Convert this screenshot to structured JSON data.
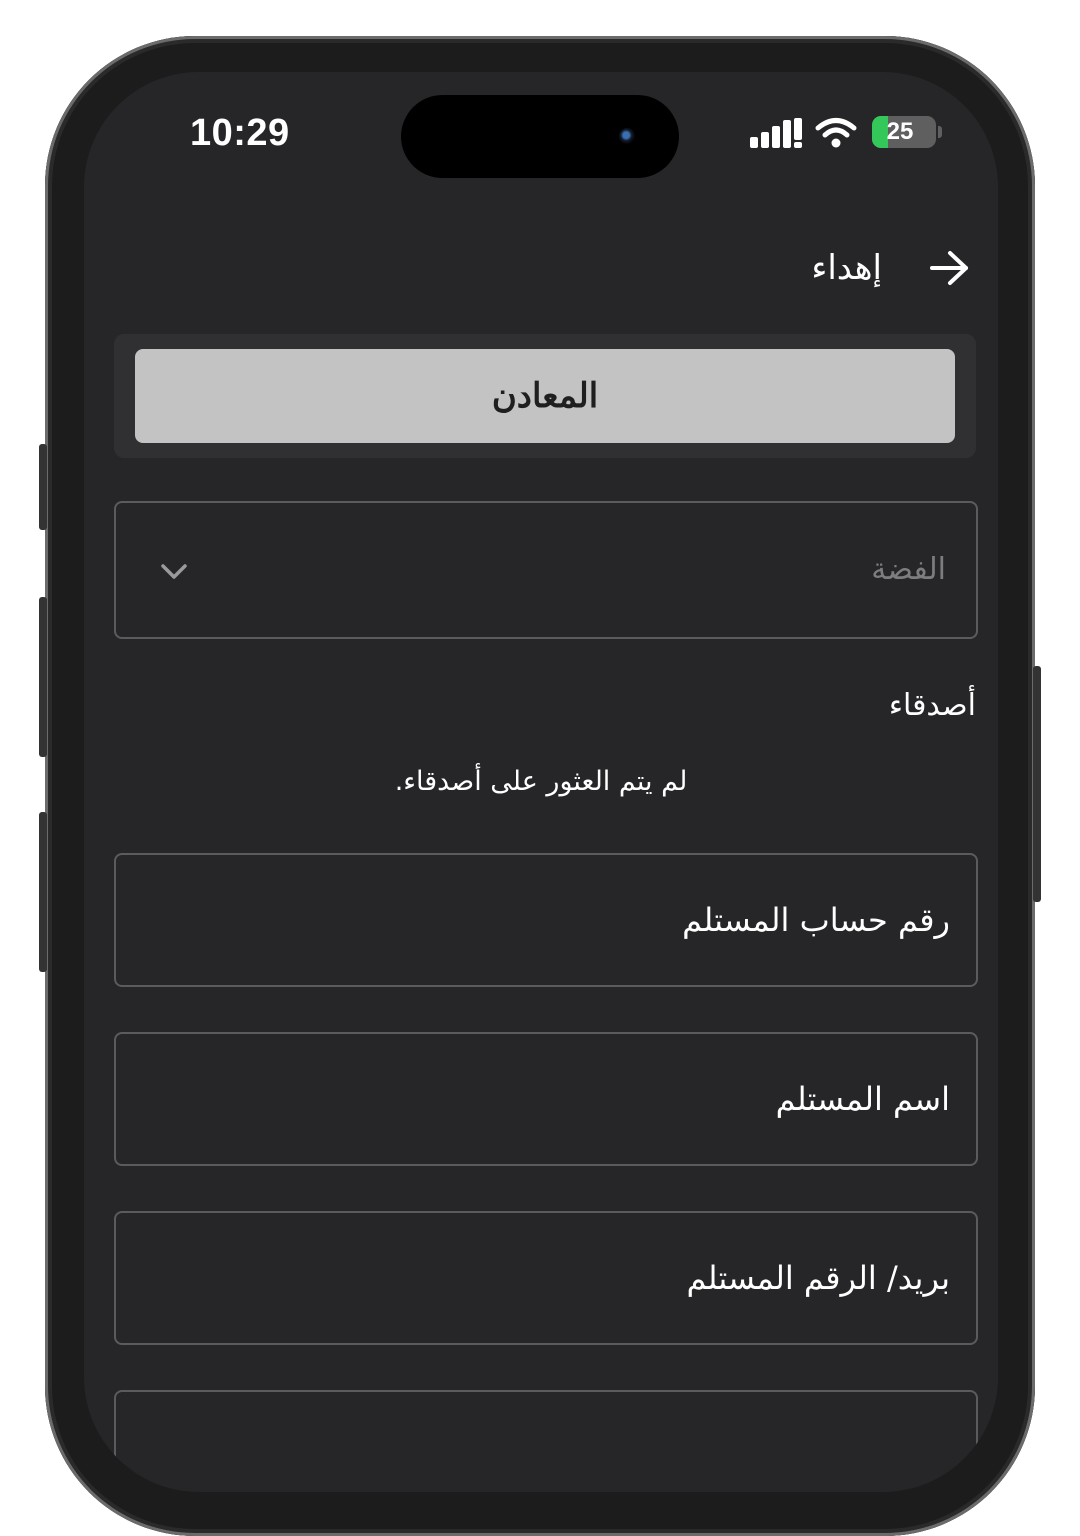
{
  "status_bar": {
    "time": "10:29",
    "battery_level": "25",
    "battery_fraction": 0.25,
    "icons": [
      "signal-icon",
      "wifi-icon",
      "battery-charging-icon"
    ]
  },
  "header": {
    "title": "إهداء",
    "back_icon": "arrow-right-icon"
  },
  "segment": {
    "selected_label": "المعادن"
  },
  "metal_select": {
    "value": "الفضة",
    "icon": "chevron-down-icon"
  },
  "friends": {
    "label": "أصدقاء",
    "empty_text": "لم يتم العثور على أصدقاء."
  },
  "form": {
    "account_number_label": "رقم حساب المستلم",
    "recipient_name_label": "اسم المستلم",
    "email_phone_label": "بريد/ الرقم المستلم"
  },
  "colors": {
    "screen_background": "#262628",
    "segment_selected": "#c3c3c3",
    "field_border": "#5b5b5d",
    "battery_charge": "#34c759"
  }
}
